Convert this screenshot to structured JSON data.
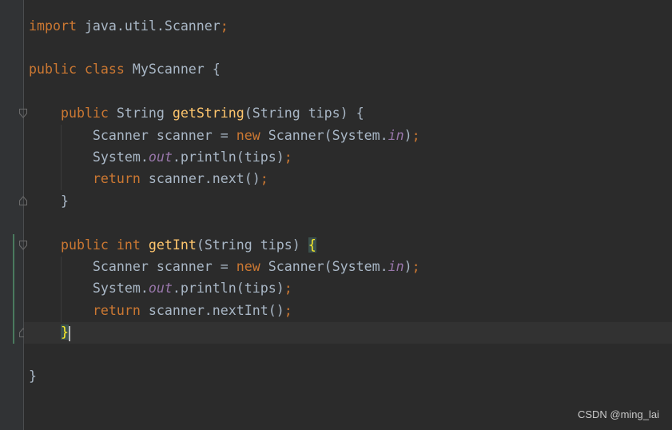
{
  "editor": {
    "lines": [
      [
        [
          "kw",
          "import "
        ],
        [
          "tx",
          "java.util.Scanner"
        ],
        [
          "kw",
          ";"
        ]
      ],
      [],
      [
        [
          "kw",
          "public class "
        ],
        [
          "tx",
          "MyScanner {"
        ]
      ],
      [],
      [
        [
          "tx",
          "    "
        ],
        [
          "kw",
          "public "
        ],
        [
          "tx",
          "String "
        ],
        [
          "fn",
          "getString"
        ],
        [
          "tx",
          "(String tips) {"
        ]
      ],
      [
        [
          "tx",
          "        Scanner scanner = "
        ],
        [
          "kw",
          "new "
        ],
        [
          "tx",
          "Scanner(System."
        ],
        [
          "st",
          "in"
        ],
        [
          "tx",
          ")"
        ],
        [
          "kw",
          ";"
        ]
      ],
      [
        [
          "tx",
          "        System."
        ],
        [
          "st",
          "out"
        ],
        [
          "tx",
          ".println(tips)"
        ],
        [
          "kw",
          ";"
        ]
      ],
      [
        [
          "tx",
          "        "
        ],
        [
          "kw",
          "return "
        ],
        [
          "tx",
          "scanner.next()"
        ],
        [
          "kw",
          ";"
        ]
      ],
      [
        [
          "tx",
          "    }"
        ]
      ],
      [],
      [
        [
          "tx",
          "    "
        ],
        [
          "kw",
          "public int "
        ],
        [
          "fn",
          "getInt"
        ],
        [
          "tx",
          "(String tips) "
        ],
        [
          "hl",
          "{"
        ]
      ],
      [
        [
          "tx",
          "        Scanner scanner = "
        ],
        [
          "kw",
          "new "
        ],
        [
          "tx",
          "Scanner(System."
        ],
        [
          "st",
          "in"
        ],
        [
          "tx",
          ")"
        ],
        [
          "kw",
          ";"
        ]
      ],
      [
        [
          "tx",
          "        System."
        ],
        [
          "st",
          "out"
        ],
        [
          "tx",
          ".println(tips)"
        ],
        [
          "kw",
          ";"
        ]
      ],
      [
        [
          "tx",
          "        "
        ],
        [
          "kw",
          "return "
        ],
        [
          "tx",
          "scanner.nextInt()"
        ],
        [
          "kw",
          ";"
        ]
      ],
      [
        [
          "tx",
          "    "
        ],
        [
          "hl",
          "}"
        ]
      ],
      [],
      [
        [
          "tx",
          "}"
        ]
      ]
    ]
  },
  "colors": {
    "background": "#2b2b2b",
    "keyword": "#cc7832",
    "method": "#ffc66d",
    "static_field": "#9876aa",
    "plain_text": "#a9b7c6",
    "matched_brace": "#ffef28"
  },
  "watermark": {
    "text": "CSDN @ming_lai"
  }
}
